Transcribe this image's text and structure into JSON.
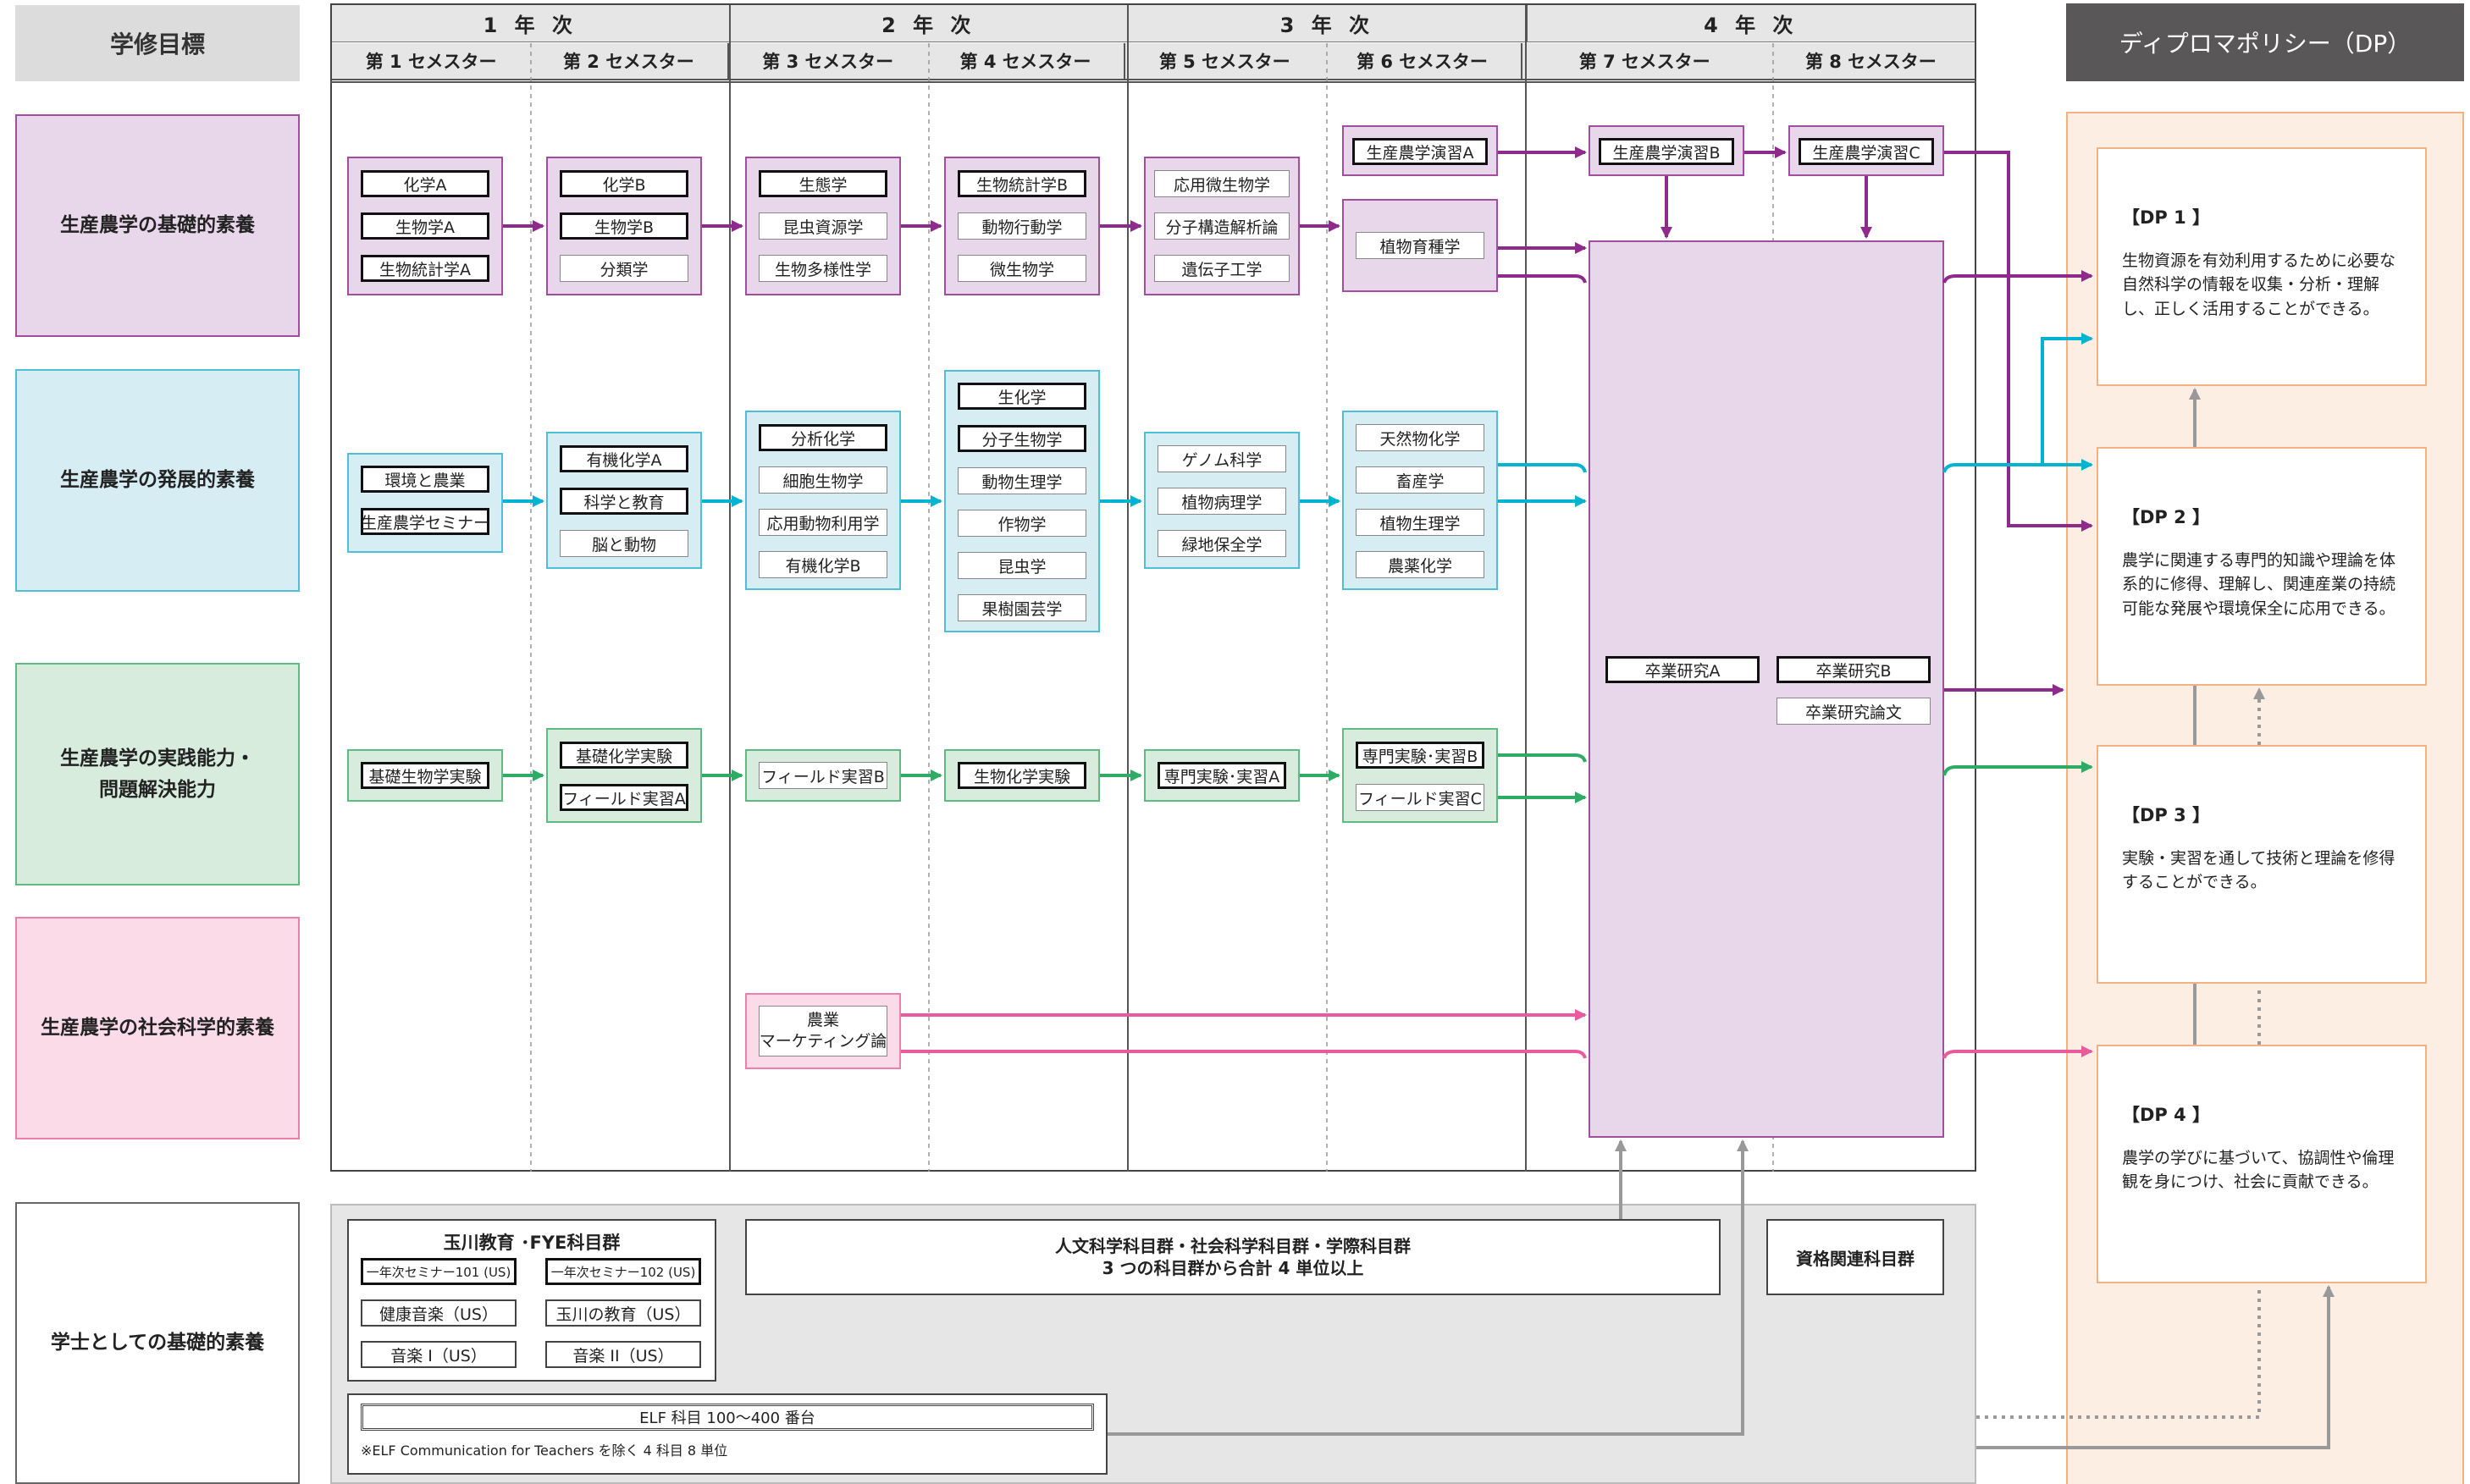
{
  "goals": {
    "header": "学修目標",
    "rows": [
      {
        "label": "生産農学の基礎的素養"
      },
      {
        "label": "生産農学の発展的素養"
      },
      {
        "label": "生産農学の実践能力・問題解決能力"
      },
      {
        "label": "生産農学の社会科学的素養"
      },
      {
        "label": "学士としての基礎的素養"
      }
    ]
  },
  "years": [
    "1 年 次",
    "2 年 次",
    "3 年 次",
    "4 年 次"
  ],
  "semesters": [
    "第 1 セメスター",
    "第 2 セメスター",
    "第 3 セメスター",
    "第 4 セメスター",
    "第 5 セメスター",
    "第 6 セメスター",
    "第 7 セメスター",
    "第 8 セメスター"
  ],
  "courses": {
    "s1_basic": [
      "化学A",
      "生物学A",
      "生物統計学A"
    ],
    "s2_basic": [
      "化学B",
      "生物学B",
      "分類学"
    ],
    "s3_basic": [
      "生態学",
      "昆虫資源学",
      "生物多様性学"
    ],
    "s4_basic": [
      "生物統計学B",
      "動物行動学",
      "微生物学"
    ],
    "s5_basic": [
      "応用微生物学",
      "分子構造解析論",
      "遺伝子工学"
    ],
    "s6_basic_top": "生産農学演習A",
    "s6_basic": "植物育種学",
    "s7_top": "生産農学演習B",
    "s8_top": "生産農学演習C",
    "s1_adv": [
      "環境と農業",
      "生産農学セミナー"
    ],
    "s2_adv": [
      "有機化学A",
      "科学と教育",
      "脳と動物"
    ],
    "s3_adv": [
      "分析化学",
      "細胞生物学",
      "応用動物利用学",
      "有機化学B"
    ],
    "s4_adv": [
      "生化学",
      "分子生物学",
      "動物生理学",
      "作物学",
      "昆虫学",
      "果樹園芸学"
    ],
    "s5_adv": [
      "ゲノム科学",
      "植物病理学",
      "緑地保全学"
    ],
    "s6_adv": [
      "天然物化学",
      "畜産学",
      "植物生理学",
      "農薬化学"
    ],
    "thesis_a": "卒業研究A",
    "thesis_b": "卒業研究B",
    "thesis_paper": "卒業研究論文",
    "s1_prac": "基礎生物学実験",
    "s2_prac": [
      "基礎化学実験",
      "フィールド実習A"
    ],
    "s3_prac": "フィールド実習B",
    "s4_prac": "生物化学実験",
    "s5_prac": "専門実験･実習A",
    "s6_prac": [
      "専門実験･実習B",
      "フィールド実習C"
    ],
    "s3_soc": [
      "農業",
      "マーケティング論"
    ]
  },
  "general": {
    "fye_title": "玉川教育 ･FYE科目群",
    "fye_items": [
      "一年次セミナー101 (US)",
      "一年次セミナー102 (US)",
      "健康音楽（US）",
      "玉川の教育（US）",
      "音楽 I（US）",
      "音楽 II（US）"
    ],
    "humanities_l1": "人文科学科目群・社会科学科目群・学際科目群",
    "humanities_l2": "3 つの科目群から合計 4 単位以上",
    "qualification": "資格関連科目群",
    "elf_title": "ELF 科目 100～400 番台",
    "elf_note": "※ELF Communication for Teachers を除く 4 科目 8 単位"
  },
  "dp": {
    "header": "ディプロマポリシー（DP）",
    "items": [
      {
        "title": "【DP 1 】",
        "text": "生物資源を有効利用するために必要な自然科学の情報を収集・分析・理解し、正しく活用することができる。"
      },
      {
        "title": "【DP 2 】",
        "text": "農学に関連する専門的知識や理論を体系的に修得、理解し、関連産業の持続可能な発展や環境保全に応用できる。"
      },
      {
        "title": "【DP 3 】",
        "text": "実験・実習を通して技術と理論を修得することができる。"
      },
      {
        "title": "【DP 4 】",
        "text": "農学の学びに基づいて、協調性や倫理観を身につけ、社会に貢献できる。"
      }
    ]
  },
  "colors": {
    "purple": "#8e2a8b",
    "purple_bg": "#e8d6ea",
    "cyan": "#00b3d1",
    "cyan_bg": "#d5edf3",
    "green": "#2eac66",
    "green_bg": "#d7ecdd",
    "pink": "#e95b9d",
    "pink_bg": "#fadbe7",
    "orange_bg": "#fdeee3"
  }
}
